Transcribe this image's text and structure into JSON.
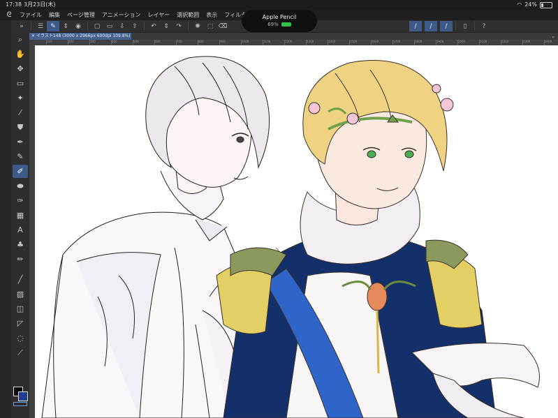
{
  "status_bar": {
    "time": "17:38",
    "date": "3月23日(木)",
    "battery_percent": "24%",
    "battery_level": 0.24
  },
  "menu": {
    "items": [
      "ファイル",
      "編集",
      "ページ管理",
      "アニメーション",
      "レイヤー",
      "選択範囲",
      "表示",
      "フィルター"
    ]
  },
  "pencil_popup": {
    "title": "Apple Pencil",
    "percent": "69%",
    "level": 0.69
  },
  "document_tab": {
    "label": "イラスト148 (3000 x 2966px 600dpi 109.8%)"
  },
  "ruler": {
    "labels": [
      "100",
      "200",
      "300",
      "400",
      "500",
      "600",
      "700",
      "800",
      "900",
      "1000",
      "1100",
      "1200",
      "1300",
      "1400",
      "1500",
      "1600",
      "1700",
      "1800",
      "1900",
      "2000",
      "2100",
      "2200",
      "2300",
      "2400"
    ]
  },
  "colors": {
    "main_color": "#0a0a0a",
    "sub_color": "#233c8f",
    "accent": "#3e5a88"
  },
  "tools": [
    "zoom-icon",
    "hand-icon",
    "move-icon",
    "selection-rect-icon",
    "magic-wand-icon",
    "eyedropper-icon",
    "fill-icon",
    "pen-icon",
    "pencil-icon",
    "brush-icon",
    "eraser-icon",
    "blend-icon",
    "pattern-icon",
    "text-icon",
    "airbrush-icon",
    "decoration-icon",
    "line-icon",
    "gradient-icon",
    "layer-op-icon",
    "ruler-icon",
    "lasso-icon",
    "correct-line-icon"
  ]
}
